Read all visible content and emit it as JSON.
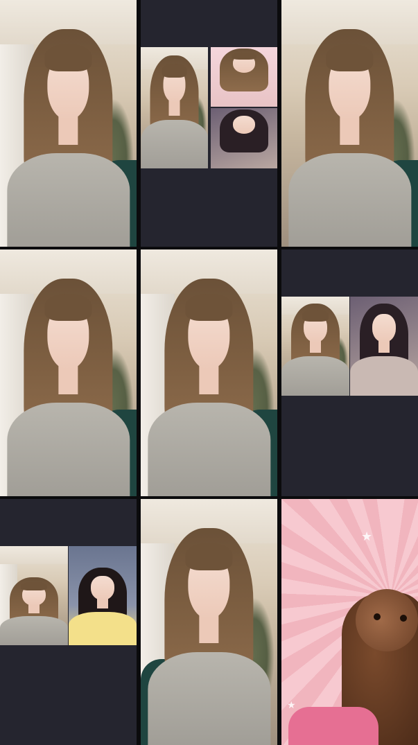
{
  "tiles": [
    {
      "id": 1,
      "kind": "single-feed"
    },
    {
      "id": 2,
      "kind": "multi-feed",
      "feeds": 3
    },
    {
      "id": 3,
      "kind": "single-feed"
    },
    {
      "id": 4,
      "kind": "single-feed"
    },
    {
      "id": 5,
      "kind": "single-feed"
    },
    {
      "id": 6,
      "kind": "multi-feed",
      "feeds": 2
    },
    {
      "id": 7,
      "kind": "multi-feed",
      "feeds": 2
    },
    {
      "id": 8,
      "kind": "single-feed"
    },
    {
      "id": 9,
      "kind": "single-feed",
      "content": "monkey"
    }
  ],
  "colors": {
    "background": "#0b0b0d",
    "empty_panel": "#25252f",
    "accent_pink": "#f1b5be"
  },
  "icons": {
    "sparkle": "★"
  }
}
